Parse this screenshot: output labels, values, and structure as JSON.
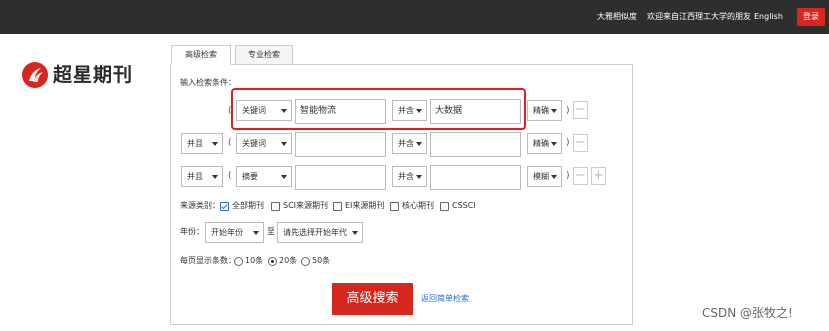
{
  "topbar": {
    "link1": "大雅相似度",
    "welcome": "欢迎来自江西理工大学的朋友",
    "english": "English",
    "login": "登录"
  },
  "brand": {
    "name": "超星期刊"
  },
  "tabs": [
    "高级检索",
    "专业检索"
  ],
  "form": {
    "conditions_label": "输入检索条件：",
    "rows": [
      {
        "logic": "",
        "field": "关键词",
        "value1": "智能物流",
        "join": "并含",
        "value2": "大数据",
        "match": "精确"
      },
      {
        "logic": "并且",
        "field": "关键词",
        "value1": "",
        "join": "并含",
        "value2": "",
        "match": "精确"
      },
      {
        "logic": "并且",
        "field": "摘要",
        "value1": "",
        "join": "并含",
        "value2": "",
        "match": "模糊"
      }
    ],
    "source_label": "来源类别：",
    "sources": [
      {
        "label": "全部期刊",
        "checked": true
      },
      {
        "label": "SCI来源期刊",
        "checked": false
      },
      {
        "label": "EI来源期刊",
        "checked": false
      },
      {
        "label": "核心期刊",
        "checked": false
      },
      {
        "label": "CSSCI",
        "checked": false
      }
    ],
    "year_label": "年份：",
    "year_start": "开始年份",
    "year_to": "至",
    "year_end": "请先选择开始年代",
    "perpage_label": "每页显示条数：",
    "perpage_options": [
      {
        "label": "10条",
        "selected": false
      },
      {
        "label": "20条",
        "selected": true
      },
      {
        "label": "50条",
        "selected": false
      }
    ],
    "search_button": "高级搜索",
    "back_link": "返回简单检索"
  },
  "watermark": "CSDN @张牧之!",
  "colors": {
    "brand_red": "#d7261b",
    "topbar": "#2e2e2e",
    "link_blue": "#2a6ad8"
  }
}
